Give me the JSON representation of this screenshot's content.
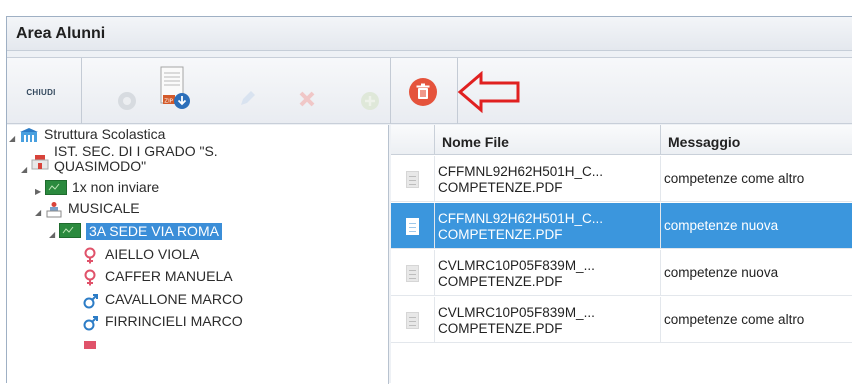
{
  "window": {
    "title": "Area Alunni"
  },
  "toolbar": {
    "chiudi_label": "CHIUDI",
    "buttons": [
      {
        "name": "circle-icon",
        "enabled": false
      },
      {
        "name": "zip-download-icon",
        "enabled": true
      },
      {
        "name": "pencil-icon",
        "enabled": false
      },
      {
        "name": "x-icon",
        "enabled": false
      },
      {
        "name": "add-icon",
        "enabled": false
      },
      {
        "name": "trash-icon",
        "enabled": true
      }
    ],
    "annotation": "red-arrow-icon"
  },
  "tree": {
    "root": "Struttura Scolastica",
    "school": "IST. SEC. DI I GRADO \"S.\nQUASIMODO\"",
    "class_1": "1x non inviare",
    "group": "MUSICALE",
    "selected_class": "3A SEDE VIA ROMA",
    "students": [
      {
        "name": "AIELLO VIOLA",
        "gender": "female"
      },
      {
        "name": "CAFFER MANUELA",
        "gender": "female"
      },
      {
        "name": "CAVALLONE MARCO",
        "gender": "male"
      },
      {
        "name": "FIRRINCIELI MARCO",
        "gender": "male"
      }
    ]
  },
  "grid": {
    "columns": [
      "Nome File",
      "Messaggio"
    ],
    "rows": [
      {
        "file": "CFFMNL92H62H501H_C...\nCOMPETENZE.PDF",
        "message": "competenze come altro",
        "selected": false
      },
      {
        "file": "CFFMNL92H62H501H_C...\nCOMPETENZE.PDF",
        "message": "competenze nuova",
        "selected": true
      },
      {
        "file": "CVLMRC10P05F839M_...\nCOMPETENZE.PDF",
        "message": "competenze nuova",
        "selected": false
      },
      {
        "file": "CVLMRC10P05F839M_...\nCOMPETENZE.PDF",
        "message": "competenze come altro",
        "selected": false
      }
    ]
  },
  "colors": {
    "selection": "#3b96dd",
    "female": "#e0526a",
    "male": "#2c7cc6",
    "trash_button": "#e5533c",
    "annotation_arrow": "#e02020"
  }
}
